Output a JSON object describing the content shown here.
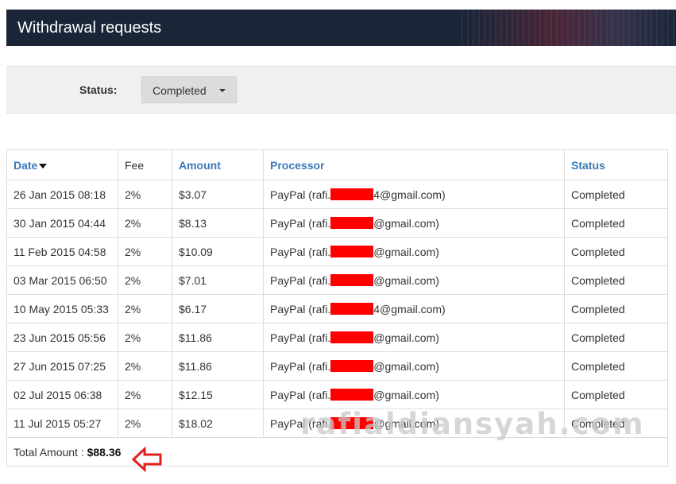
{
  "header": {
    "title": "Withdrawal requests"
  },
  "filter": {
    "label": "Status:",
    "selected": "Completed"
  },
  "table": {
    "columns": [
      "Date",
      "Fee",
      "Amount",
      "Processor",
      "Status"
    ],
    "rows": [
      {
        "date": "26 Jan 2015 08:18",
        "fee": "2%",
        "amount": "$3.07",
        "processor_prefix": "PayPal (rafi.",
        "processor_suffix": "4@gmail.com)",
        "status": "Completed"
      },
      {
        "date": "30 Jan 2015 04:44",
        "fee": "2%",
        "amount": "$8.13",
        "processor_prefix": "PayPal (rafi.",
        "processor_suffix": "@gmail.com)",
        "status": "Completed"
      },
      {
        "date": "11 Feb 2015 04:58",
        "fee": "2%",
        "amount": "$10.09",
        "processor_prefix": "PayPal (rafi.",
        "processor_suffix": "@gmail.com)",
        "status": "Completed"
      },
      {
        "date": "03 Mar 2015 06:50",
        "fee": "2%",
        "amount": "$7.01",
        "processor_prefix": "PayPal (rafi.",
        "processor_suffix": "@gmail.com)",
        "status": "Completed"
      },
      {
        "date": "10 May 2015 05:33",
        "fee": "2%",
        "amount": "$6.17",
        "processor_prefix": "PayPal (rafi.",
        "processor_suffix": "4@gmail.com)",
        "status": "Completed"
      },
      {
        "date": "23 Jun 2015 05:56",
        "fee": "2%",
        "amount": "$11.86",
        "processor_prefix": "PayPal (rafi.",
        "processor_suffix": "@gmail.com)",
        "status": "Completed"
      },
      {
        "date": "27 Jun 2015 07:25",
        "fee": "2%",
        "amount": "$11.86",
        "processor_prefix": "PayPal (rafi.",
        "processor_suffix": "@gmail.com)",
        "status": "Completed"
      },
      {
        "date": "02 Jul 2015 06:38",
        "fee": "2%",
        "amount": "$12.15",
        "processor_prefix": "PayPal (rafi.",
        "processor_suffix": "@gmail.com)",
        "status": "Completed"
      },
      {
        "date": "11 Jul 2015 05:27",
        "fee": "2%",
        "amount": "$18.02",
        "processor_prefix": "PayPal (rafi.",
        "processor_suffix": "@gmail.com)",
        "status": "Completed"
      }
    ]
  },
  "total": {
    "label": "Total Amount : ",
    "value": "$88.36"
  },
  "watermark": {
    "text": "rafialdiansyah.com"
  },
  "icons": {
    "sort": "sort-desc-icon",
    "pointer": "left-arrow-outline-icon"
  },
  "colors": {
    "header_bg": "#1b2538",
    "link": "#3a7ab8",
    "redaction": "#ff0000",
    "arrow": "#e0201b"
  }
}
